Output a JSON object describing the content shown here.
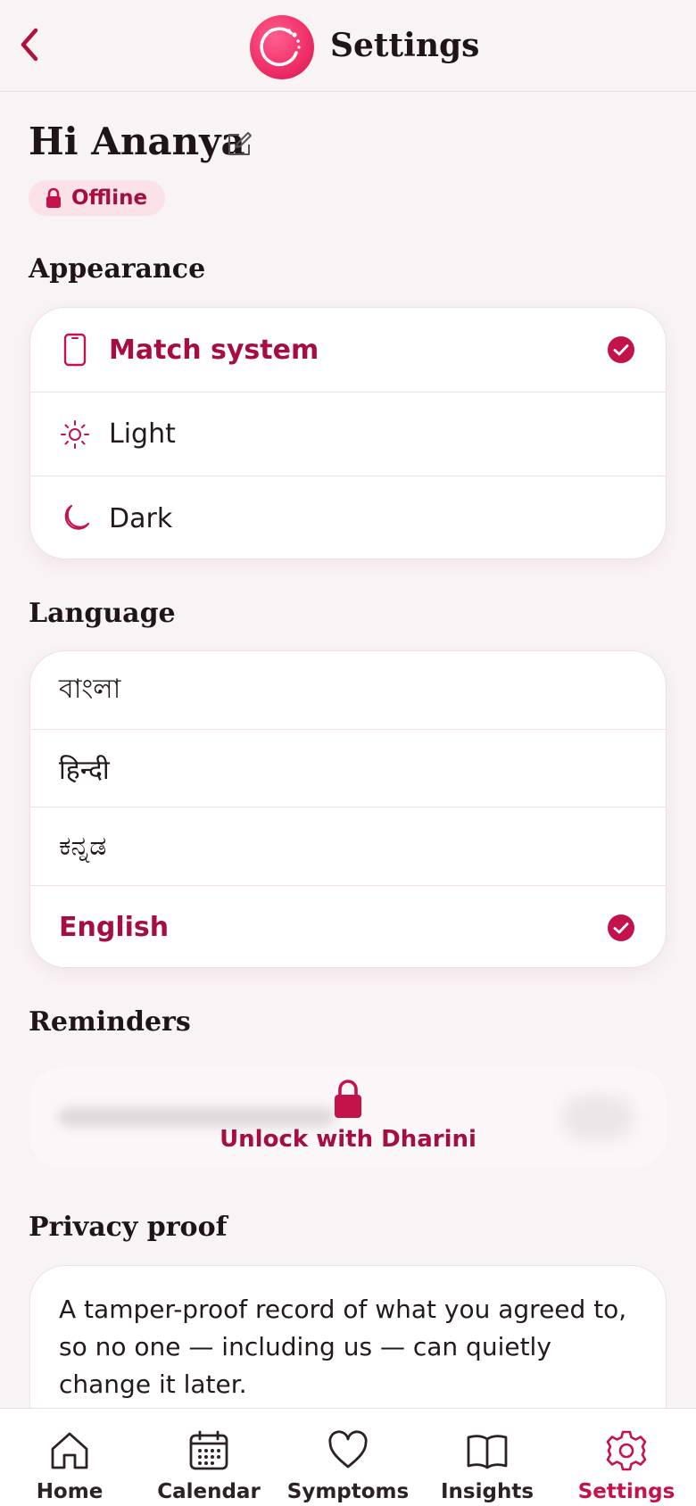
{
  "header": {
    "title": "Settings"
  },
  "greeting": {
    "text": "Hi Ananya",
    "status_badge": "Offline"
  },
  "appearance": {
    "title": "Appearance",
    "options": [
      {
        "label": "Match system",
        "icon": "phone-icon",
        "selected": true
      },
      {
        "label": "Light",
        "icon": "sun-icon",
        "selected": false
      },
      {
        "label": "Dark",
        "icon": "moon-icon",
        "selected": false
      }
    ]
  },
  "language": {
    "title": "Language",
    "options": [
      {
        "label": "বাংলা",
        "selected": false
      },
      {
        "label": "हिन्दी",
        "selected": false
      },
      {
        "label": "ಕನ್ನಡ",
        "selected": false
      },
      {
        "label": "English",
        "selected": true
      }
    ]
  },
  "reminders": {
    "title": "Reminders",
    "unlock_label": "Unlock with Dharini"
  },
  "privacy": {
    "title": "Privacy proof",
    "description": "A tamper-proof record of what you agreed to, so no one — including us — can quietly change it later."
  },
  "nav": {
    "items": [
      {
        "label": "Home",
        "icon": "home-icon",
        "active": false
      },
      {
        "label": "Calendar",
        "icon": "calendar-icon",
        "active": false
      },
      {
        "label": "Symptoms",
        "icon": "heart-icon",
        "active": false
      },
      {
        "label": "Insights",
        "icon": "book-icon",
        "active": false
      },
      {
        "label": "Settings",
        "icon": "gear-icon",
        "active": true
      }
    ]
  },
  "colors": {
    "accent": "#a50e3f",
    "brand_pink": "#f0326a",
    "background": "#f8f3f5"
  }
}
